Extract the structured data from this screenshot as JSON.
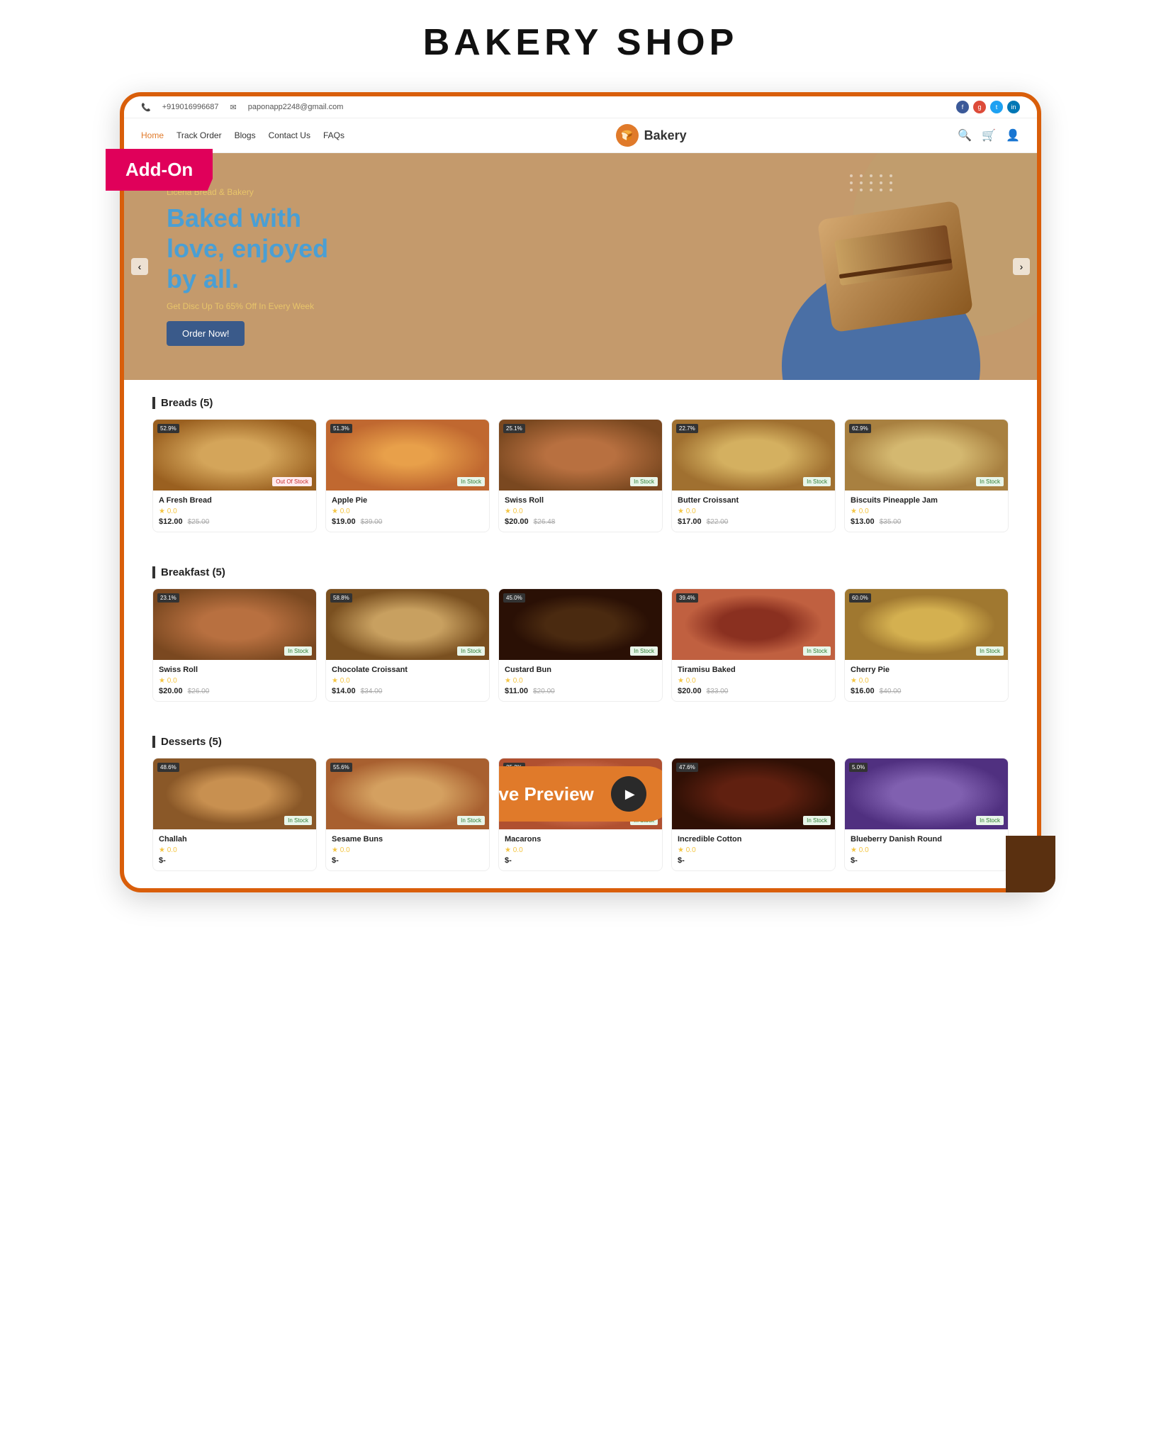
{
  "page": {
    "title": "BAKERY SHOP"
  },
  "addon_badge": "Add-On",
  "topbar": {
    "phone": "+919016996687",
    "email": "paponapp2248@gmail.com"
  },
  "nav": {
    "links": [
      "Home",
      "Track Order",
      "Blogs",
      "Contact Us",
      "FAQs"
    ],
    "active": "Home",
    "logo_text": "Bakery"
  },
  "hero": {
    "sub1": "Liceria",
    "sub2": "Bread & Bakery",
    "title_line1": "Baked with",
    "title_line2": "love,",
    "title_highlight": "enjoyed",
    "title_line3": "by all.",
    "discount": "Get Disc Up To 65% Off In",
    "discount_highlight": "Every Week",
    "btn_label": "Order Now!",
    "arrow_left": "‹",
    "arrow_right": "›"
  },
  "sections": [
    {
      "title": "Breads (5)",
      "products": [
        {
          "name": "A Fresh Bread",
          "badge": "52.9%",
          "status": "Out Of Stock",
          "in_stock": false,
          "rating": "0.0",
          "price": "$12.00",
          "old_price": "$25.00",
          "food_class": "food-fresh-bread"
        },
        {
          "name": "Apple Pie",
          "badge": "51.3%",
          "status": "In Stock",
          "in_stock": true,
          "rating": "0.0",
          "price": "$19.00",
          "old_price": "$39.00",
          "food_class": "food-apple-pie"
        },
        {
          "name": "Swiss Roll",
          "badge": "25.1%",
          "status": "In Stock",
          "in_stock": true,
          "rating": "0.0",
          "price": "$20.00",
          "old_price": "$26.48",
          "food_class": "food-swiss-roll"
        },
        {
          "name": "Butter Croissant",
          "badge": "22.7%",
          "status": "In Stock",
          "in_stock": true,
          "rating": "0.0",
          "price": "$17.00",
          "old_price": "$22.00",
          "food_class": "food-butter-croissant"
        },
        {
          "name": "Biscuits Pineapple Jam",
          "badge": "62.9%",
          "status": "In Stock",
          "in_stock": true,
          "rating": "0.0",
          "price": "$13.00",
          "old_price": "$35.00",
          "food_class": "food-biscuits"
        }
      ]
    },
    {
      "title": "Breakfast (5)",
      "products": [
        {
          "name": "Swiss Roll",
          "badge": "23.1%",
          "status": "In Stock",
          "in_stock": true,
          "rating": "0.0",
          "price": "$20.00",
          "old_price": "$26.00",
          "food_class": "food-swiss-roll-b"
        },
        {
          "name": "Chocolate Croissant",
          "badge": "58.8%",
          "status": "In Stock",
          "in_stock": true,
          "rating": "0.0",
          "price": "$14.00",
          "old_price": "$34.00",
          "food_class": "food-choc-croissant"
        },
        {
          "name": "Custard Bun",
          "badge": "45.0%",
          "status": "In Stock",
          "in_stock": true,
          "rating": "0.0",
          "price": "$11.00",
          "old_price": "$20.00",
          "food_class": "food-custard-bun"
        },
        {
          "name": "Tiramisu Baked",
          "badge": "39.4%",
          "status": "In Stock",
          "in_stock": true,
          "rating": "0.0",
          "price": "$20.00",
          "old_price": "$33.00",
          "food_class": "food-tiramisu"
        },
        {
          "name": "Cherry Pie",
          "badge": "60.0%",
          "status": "In Stock",
          "in_stock": true,
          "rating": "0.0",
          "price": "$16.00",
          "old_price": "$40.00",
          "food_class": "food-cherry-pie"
        }
      ]
    },
    {
      "title": "Desserts (5)",
      "products": [
        {
          "name": "Challah",
          "badge": "48.6%",
          "status": "In Stock",
          "in_stock": true,
          "rating": "0.0",
          "price": "$-",
          "old_price": "",
          "food_class": "food-challah"
        },
        {
          "name": "Sesame Buns",
          "badge": "55.6%",
          "status": "In Stock",
          "in_stock": true,
          "rating": "0.0",
          "price": "$-",
          "old_price": "",
          "food_class": "food-sesame"
        },
        {
          "name": "Macarons",
          "badge": "25.2%",
          "status": "In Stock",
          "in_stock": true,
          "rating": "0.0",
          "price": "$-",
          "old_price": "",
          "food_class": "food-macarons"
        },
        {
          "name": "Incredible Cotton",
          "badge": "47.6%",
          "status": "In Stock",
          "in_stock": true,
          "rating": "0.0",
          "price": "$-",
          "old_price": "",
          "food_class": "food-incredible"
        },
        {
          "name": "Blueberry Danish Round",
          "badge": "5.0%",
          "status": "In Stock",
          "in_stock": true,
          "rating": "0.0",
          "price": "$-",
          "old_price": "",
          "food_class": "food-blueberry"
        }
      ]
    }
  ],
  "live_preview": {
    "label": "Live Preview",
    "btn_symbol": "▶"
  }
}
